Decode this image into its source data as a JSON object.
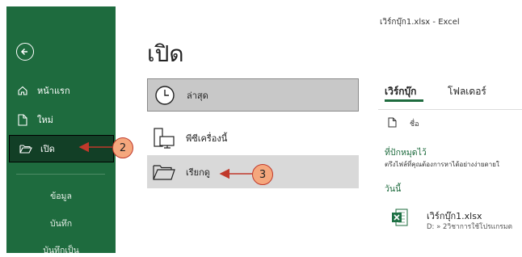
{
  "window": {
    "title": "เวิร์กบุ๊ก1.xlsx  -  Excel"
  },
  "sidebar": {
    "items": [
      {
        "label": "หน้าแรก"
      },
      {
        "label": "ใหม่"
      },
      {
        "label": "เปิด"
      }
    ],
    "lower_items": [
      {
        "label": "ข้อมูล"
      },
      {
        "label": "บันทึก"
      },
      {
        "label": "บันทึกเป็น"
      }
    ]
  },
  "main": {
    "title": "เปิด",
    "locations": [
      {
        "label": "ล่าสุด",
        "icon": "clock-icon"
      },
      {
        "label": "พีซีเครื่องนี้",
        "icon": "computer-icon"
      },
      {
        "label": "เรียกดู",
        "icon": "folder-icon"
      }
    ]
  },
  "right_panel": {
    "tabs": [
      "เวิร์กบุ๊ก",
      "โฟลเดอร์"
    ],
    "name_column": "ชื่อ",
    "pinned": {
      "title": "ที่ปักหมุดไว้",
      "description": "ตรึงไฟล์ที่คุณต้องการหาได้อย่างง่ายดายใ"
    },
    "today": "วันนี้",
    "recent_file": {
      "name": "เวิร์กบุ๊ก1.xlsx",
      "path": "D: » 2วิชาการใช้โปรแกรมต"
    }
  },
  "callouts": [
    "2",
    "3"
  ],
  "colors": {
    "sidebar_bg": "#1e6b3e",
    "selected_bg": "#123f26",
    "callout_fill": "#f5a77d",
    "arrow": "#c0392b"
  }
}
